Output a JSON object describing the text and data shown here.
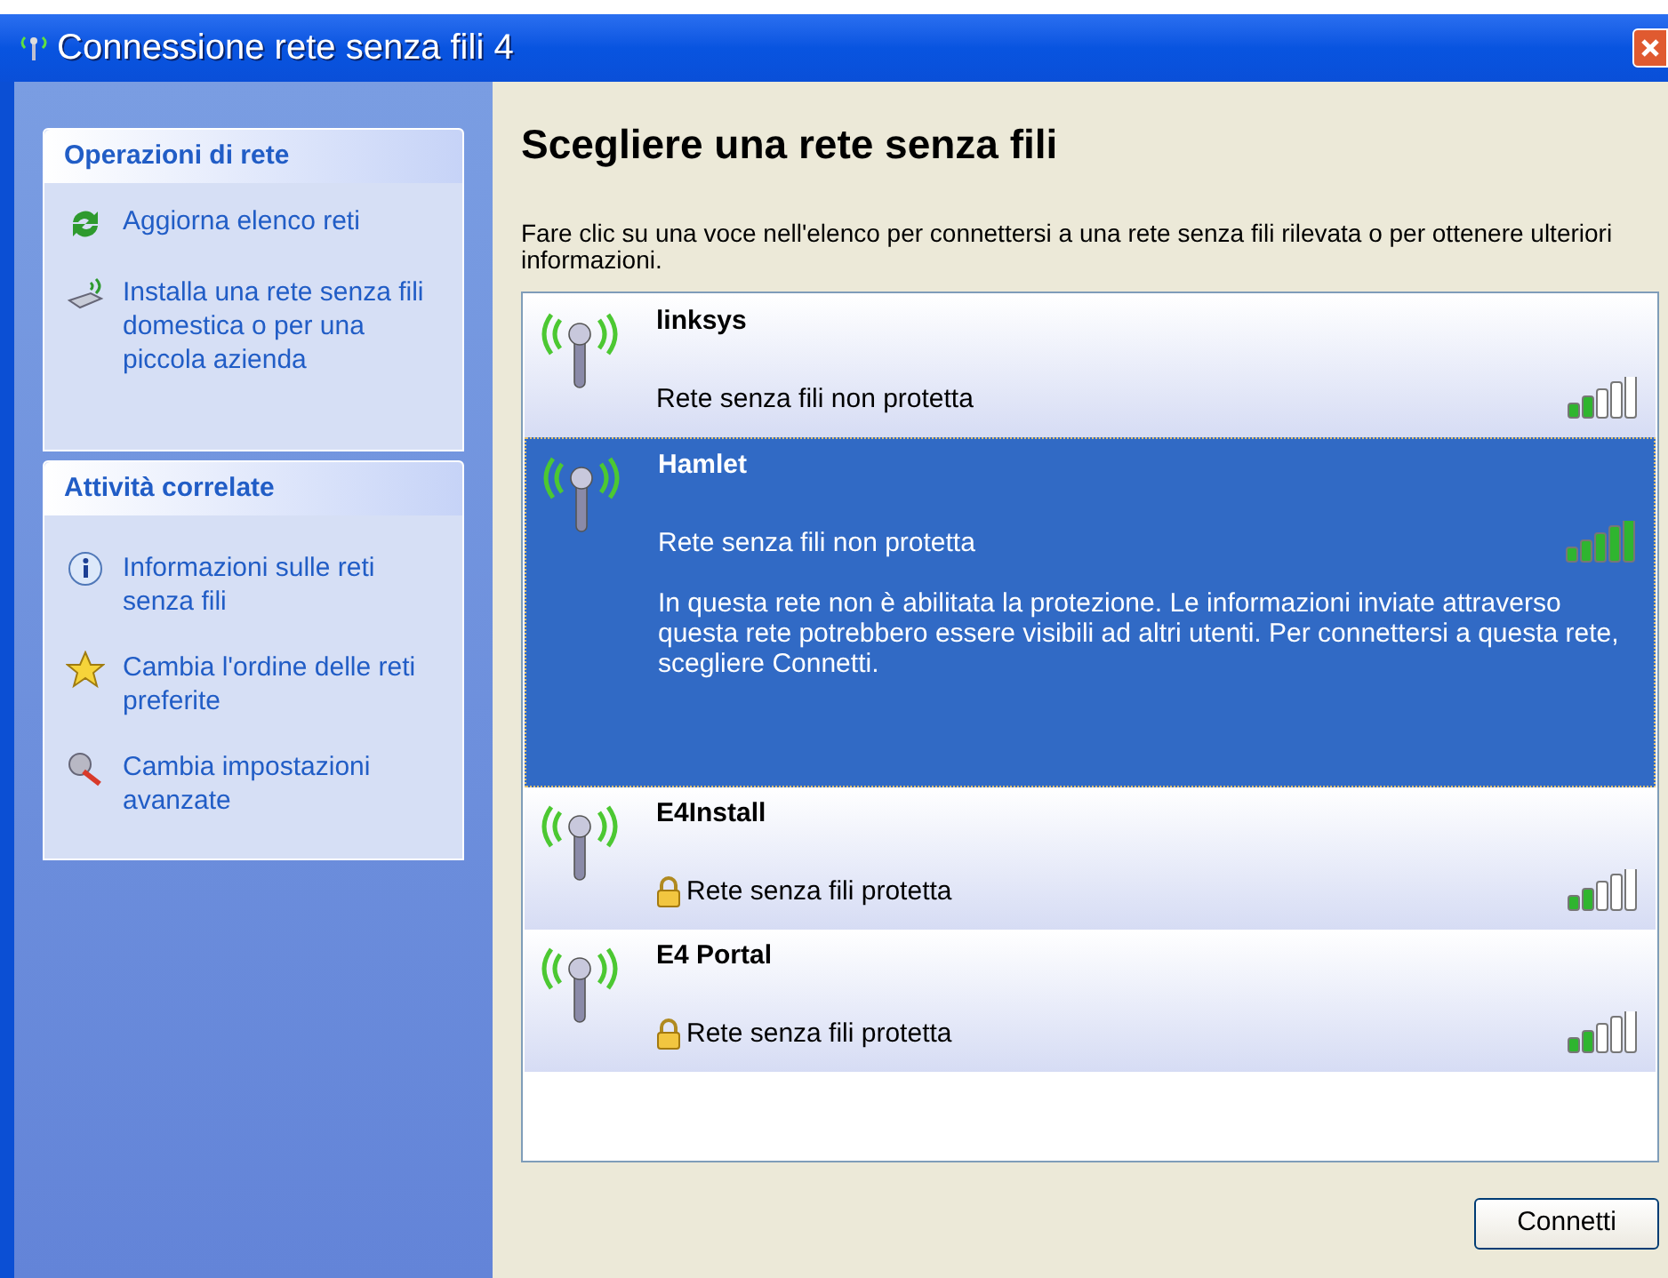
{
  "window": {
    "title": "Connessione rete senza fili 4"
  },
  "sidebar": {
    "sections": [
      {
        "title": "Operazioni di rete",
        "items": [
          {
            "kind": "refresh",
            "label": "Aggiorna elenco reti"
          },
          {
            "kind": "setup",
            "label": "Installa una rete senza fili domestica o per una piccola azienda"
          }
        ]
      },
      {
        "title": "Attività correlate",
        "items": [
          {
            "kind": "info",
            "label": "Informazioni sulle reti senza fili"
          },
          {
            "kind": "star",
            "label": "Cambia l'ordine delle reti preferite"
          },
          {
            "kind": "settings",
            "label": "Cambia impostazioni avanzate"
          }
        ]
      }
    ]
  },
  "main": {
    "title": "Scegliere una rete senza fili",
    "instructions": "Fare clic su una voce nell'elenco per connettersi a una rete senza fili rilevata o per ottenere ulteriori informazioni."
  },
  "networks": [
    {
      "name": "linksys",
      "status": "Rete senza fili non protetta",
      "secured": false,
      "level": 0.4,
      "selected": false
    },
    {
      "name": "Hamlet",
      "status": "Rete senza fili non protetta",
      "secured": false,
      "level": 1,
      "selected": true,
      "details": "In questa rete non è abilitata la protezione. Le informazioni inviate attraverso questa rete potrebbero essere visibili ad altri utenti. Per connettersi a questa rete, scegliere Connetti."
    },
    {
      "name": "E4Install",
      "status": "Rete senza fili protetta",
      "secured": true,
      "level": 0.4,
      "selected": false
    },
    {
      "name": "E4 Portal",
      "status": "Rete senza fili protetta",
      "secured": true,
      "level": 0.4,
      "selected": false
    }
  ],
  "buttons": [
    "Connetti"
  ]
}
